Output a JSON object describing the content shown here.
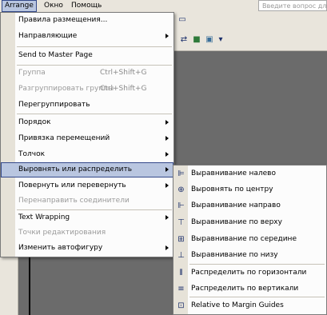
{
  "menubar": {
    "items": [
      "Arrange",
      "Окно",
      "Помощь"
    ],
    "help_search_placeholder": "Введите вопрос для"
  },
  "arrange_menu": {
    "items": [
      {
        "label": "Правила размещения...",
        "arrow": false,
        "disabled": false
      },
      {
        "label": "Направляющие",
        "arrow": true,
        "disabled": false
      },
      {
        "label": "Send to Master Page",
        "arrow": false,
        "disabled": false
      },
      {
        "label": "Группа",
        "shortcut": "Ctrl+Shift+G",
        "arrow": false,
        "disabled": true
      },
      {
        "label": "Разгруппировать группы",
        "shortcut": "Ctrl+Shift+G",
        "arrow": false,
        "disabled": true
      },
      {
        "label": "Перегруппировать",
        "arrow": false,
        "disabled": false
      },
      {
        "label": "Порядок",
        "arrow": true,
        "disabled": false
      },
      {
        "label": "Привязка перемещений",
        "arrow": true,
        "disabled": false
      },
      {
        "label": "Толчок",
        "arrow": true,
        "disabled": false
      },
      {
        "label": "Выровнять или распределить",
        "arrow": true,
        "disabled": false,
        "selected": true
      },
      {
        "label": "Повернуть или перевернуть",
        "arrow": true,
        "disabled": false
      },
      {
        "label": "Перенаправить соединители",
        "arrow": false,
        "disabled": true
      },
      {
        "label": "Text Wrapping",
        "arrow": true,
        "disabled": false
      },
      {
        "label": "Точки редактирования",
        "arrow": false,
        "disabled": true
      },
      {
        "label": "Изменить автофигуру",
        "arrow": true,
        "disabled": false
      }
    ]
  },
  "align_submenu": {
    "items": [
      {
        "label": "Выравнивание налево",
        "icon": "align-left-icon"
      },
      {
        "label": "Выровнять по центру",
        "icon": "align-center-icon"
      },
      {
        "label": "Выравнивание направо",
        "icon": "align-right-icon"
      },
      {
        "label": "Выравнивание по верху",
        "icon": "align-top-icon"
      },
      {
        "label": "Выравнивание по середине",
        "icon": "align-middle-icon"
      },
      {
        "label": "Выравнивание по низу",
        "icon": "align-bottom-icon"
      },
      {
        "label": "Распределить по горизонтали",
        "icon": "distribute-horizontal-icon"
      },
      {
        "label": "Распределить по вертикали",
        "icon": "distribute-vertical-icon"
      },
      {
        "label": "Relative to Margin Guides",
        "icon": "margin-guides-icon"
      }
    ]
  }
}
